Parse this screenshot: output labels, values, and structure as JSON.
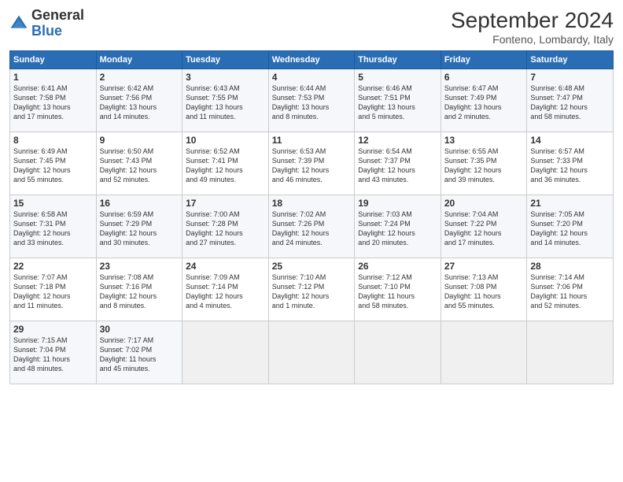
{
  "header": {
    "logo_general": "General",
    "logo_blue": "Blue",
    "month_title": "September 2024",
    "location": "Fonteno, Lombardy, Italy"
  },
  "days_of_week": [
    "Sunday",
    "Monday",
    "Tuesday",
    "Wednesday",
    "Thursday",
    "Friday",
    "Saturday"
  ],
  "weeks": [
    [
      {
        "day": "1",
        "lines": [
          "Sunrise: 6:41 AM",
          "Sunset: 7:58 PM",
          "Daylight: 13 hours",
          "and 17 minutes."
        ]
      },
      {
        "day": "2",
        "lines": [
          "Sunrise: 6:42 AM",
          "Sunset: 7:56 PM",
          "Daylight: 13 hours",
          "and 14 minutes."
        ]
      },
      {
        "day": "3",
        "lines": [
          "Sunrise: 6:43 AM",
          "Sunset: 7:55 PM",
          "Daylight: 13 hours",
          "and 11 minutes."
        ]
      },
      {
        "day": "4",
        "lines": [
          "Sunrise: 6:44 AM",
          "Sunset: 7:53 PM",
          "Daylight: 13 hours",
          "and 8 minutes."
        ]
      },
      {
        "day": "5",
        "lines": [
          "Sunrise: 6:46 AM",
          "Sunset: 7:51 PM",
          "Daylight: 13 hours",
          "and 5 minutes."
        ]
      },
      {
        "day": "6",
        "lines": [
          "Sunrise: 6:47 AM",
          "Sunset: 7:49 PM",
          "Daylight: 13 hours",
          "and 2 minutes."
        ]
      },
      {
        "day": "7",
        "lines": [
          "Sunrise: 6:48 AM",
          "Sunset: 7:47 PM",
          "Daylight: 12 hours",
          "and 58 minutes."
        ]
      }
    ],
    [
      {
        "day": "8",
        "lines": [
          "Sunrise: 6:49 AM",
          "Sunset: 7:45 PM",
          "Daylight: 12 hours",
          "and 55 minutes."
        ]
      },
      {
        "day": "9",
        "lines": [
          "Sunrise: 6:50 AM",
          "Sunset: 7:43 PM",
          "Daylight: 12 hours",
          "and 52 minutes."
        ]
      },
      {
        "day": "10",
        "lines": [
          "Sunrise: 6:52 AM",
          "Sunset: 7:41 PM",
          "Daylight: 12 hours",
          "and 49 minutes."
        ]
      },
      {
        "day": "11",
        "lines": [
          "Sunrise: 6:53 AM",
          "Sunset: 7:39 PM",
          "Daylight: 12 hours",
          "and 46 minutes."
        ]
      },
      {
        "day": "12",
        "lines": [
          "Sunrise: 6:54 AM",
          "Sunset: 7:37 PM",
          "Daylight: 12 hours",
          "and 43 minutes."
        ]
      },
      {
        "day": "13",
        "lines": [
          "Sunrise: 6:55 AM",
          "Sunset: 7:35 PM",
          "Daylight: 12 hours",
          "and 39 minutes."
        ]
      },
      {
        "day": "14",
        "lines": [
          "Sunrise: 6:57 AM",
          "Sunset: 7:33 PM",
          "Daylight: 12 hours",
          "and 36 minutes."
        ]
      }
    ],
    [
      {
        "day": "15",
        "lines": [
          "Sunrise: 6:58 AM",
          "Sunset: 7:31 PM",
          "Daylight: 12 hours",
          "and 33 minutes."
        ]
      },
      {
        "day": "16",
        "lines": [
          "Sunrise: 6:59 AM",
          "Sunset: 7:29 PM",
          "Daylight: 12 hours",
          "and 30 minutes."
        ]
      },
      {
        "day": "17",
        "lines": [
          "Sunrise: 7:00 AM",
          "Sunset: 7:28 PM",
          "Daylight: 12 hours",
          "and 27 minutes."
        ]
      },
      {
        "day": "18",
        "lines": [
          "Sunrise: 7:02 AM",
          "Sunset: 7:26 PM",
          "Daylight: 12 hours",
          "and 24 minutes."
        ]
      },
      {
        "day": "19",
        "lines": [
          "Sunrise: 7:03 AM",
          "Sunset: 7:24 PM",
          "Daylight: 12 hours",
          "and 20 minutes."
        ]
      },
      {
        "day": "20",
        "lines": [
          "Sunrise: 7:04 AM",
          "Sunset: 7:22 PM",
          "Daylight: 12 hours",
          "and 17 minutes."
        ]
      },
      {
        "day": "21",
        "lines": [
          "Sunrise: 7:05 AM",
          "Sunset: 7:20 PM",
          "Daylight: 12 hours",
          "and 14 minutes."
        ]
      }
    ],
    [
      {
        "day": "22",
        "lines": [
          "Sunrise: 7:07 AM",
          "Sunset: 7:18 PM",
          "Daylight: 12 hours",
          "and 11 minutes."
        ]
      },
      {
        "day": "23",
        "lines": [
          "Sunrise: 7:08 AM",
          "Sunset: 7:16 PM",
          "Daylight: 12 hours",
          "and 8 minutes."
        ]
      },
      {
        "day": "24",
        "lines": [
          "Sunrise: 7:09 AM",
          "Sunset: 7:14 PM",
          "Daylight: 12 hours",
          "and 4 minutes."
        ]
      },
      {
        "day": "25",
        "lines": [
          "Sunrise: 7:10 AM",
          "Sunset: 7:12 PM",
          "Daylight: 12 hours",
          "and 1 minute."
        ]
      },
      {
        "day": "26",
        "lines": [
          "Sunrise: 7:12 AM",
          "Sunset: 7:10 PM",
          "Daylight: 11 hours",
          "and 58 minutes."
        ]
      },
      {
        "day": "27",
        "lines": [
          "Sunrise: 7:13 AM",
          "Sunset: 7:08 PM",
          "Daylight: 11 hours",
          "and 55 minutes."
        ]
      },
      {
        "day": "28",
        "lines": [
          "Sunrise: 7:14 AM",
          "Sunset: 7:06 PM",
          "Daylight: 11 hours",
          "and 52 minutes."
        ]
      }
    ],
    [
      {
        "day": "29",
        "lines": [
          "Sunrise: 7:15 AM",
          "Sunset: 7:04 PM",
          "Daylight: 11 hours",
          "and 48 minutes."
        ]
      },
      {
        "day": "30",
        "lines": [
          "Sunrise: 7:17 AM",
          "Sunset: 7:02 PM",
          "Daylight: 11 hours",
          "and 45 minutes."
        ]
      },
      null,
      null,
      null,
      null,
      null
    ]
  ]
}
